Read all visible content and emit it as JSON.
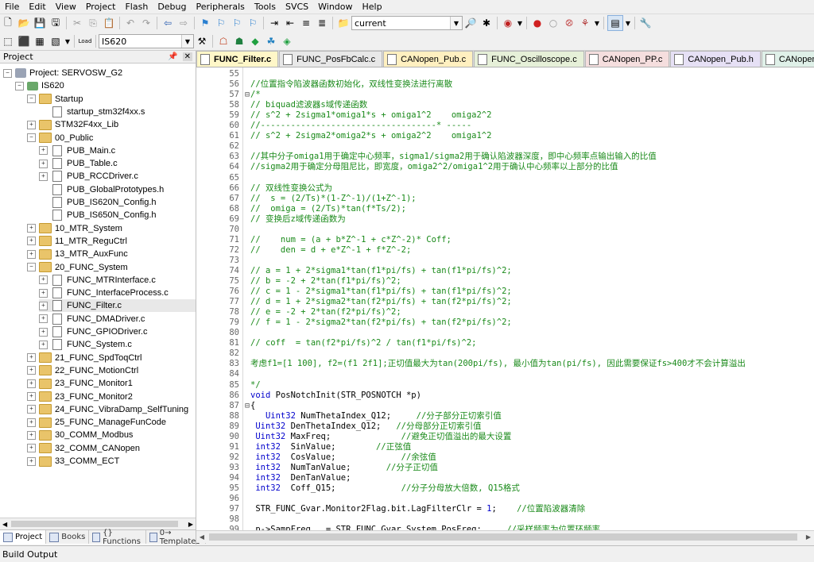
{
  "menu": [
    "File",
    "Edit",
    "View",
    "Project",
    "Flash",
    "Debug",
    "Peripherals",
    "Tools",
    "SVCS",
    "Window",
    "Help"
  ],
  "toolbar1": {
    "search_value": "current"
  },
  "toolbar2": {
    "load_label": "Load",
    "target_value": "IS620"
  },
  "project_pane": {
    "title": "Project",
    "tree": [
      {
        "label": "Project: SERVOSW_G2",
        "level": 0,
        "type": "proj",
        "toggle": "-"
      },
      {
        "label": "IS620",
        "level": 1,
        "type": "target",
        "toggle": "-"
      },
      {
        "label": "Startup",
        "level": 2,
        "type": "folder",
        "toggle": "-"
      },
      {
        "label": "startup_stm32f4xx.s",
        "level": 3,
        "type": "file",
        "toggle": ""
      },
      {
        "label": "STM32F4xx_Lib",
        "level": 2,
        "type": "folder",
        "toggle": "+"
      },
      {
        "label": "00_Public",
        "level": 2,
        "type": "folder",
        "toggle": "-"
      },
      {
        "label": "PUB_Main.c",
        "level": 3,
        "type": "file",
        "toggle": "+"
      },
      {
        "label": "PUB_Table.c",
        "level": 3,
        "type": "file",
        "toggle": "+"
      },
      {
        "label": "PUB_RCCDriver.c",
        "level": 3,
        "type": "file",
        "toggle": "+"
      },
      {
        "label": "PUB_GlobalPrototypes.h",
        "level": 3,
        "type": "file",
        "toggle": ""
      },
      {
        "label": "PUB_IS620N_Config.h",
        "level": 3,
        "type": "file",
        "toggle": ""
      },
      {
        "label": "PUB_IS650N_Config.h",
        "level": 3,
        "type": "file",
        "toggle": ""
      },
      {
        "label": "10_MTR_System",
        "level": 2,
        "type": "folder",
        "toggle": "+"
      },
      {
        "label": "11_MTR_ReguCtrl",
        "level": 2,
        "type": "folder",
        "toggle": "+"
      },
      {
        "label": "13_MTR_AuxFunc",
        "level": 2,
        "type": "folder",
        "toggle": "+"
      },
      {
        "label": "20_FUNC_System",
        "level": 2,
        "type": "folder",
        "toggle": "-"
      },
      {
        "label": "FUNC_MTRInterface.c",
        "level": 3,
        "type": "file",
        "toggle": "+"
      },
      {
        "label": "FUNC_InterfaceProcess.c",
        "level": 3,
        "type": "file",
        "toggle": "+"
      },
      {
        "label": "FUNC_Filter.c",
        "level": 3,
        "type": "file",
        "toggle": "+",
        "selected": true
      },
      {
        "label": "FUNC_DMADriver.c",
        "level": 3,
        "type": "file",
        "toggle": "+"
      },
      {
        "label": "FUNC_GPIODriver.c",
        "level": 3,
        "type": "file",
        "toggle": "+"
      },
      {
        "label": "FUNC_System.c",
        "level": 3,
        "type": "file",
        "toggle": "+"
      },
      {
        "label": "21_FUNC_SpdToqCtrl",
        "level": 2,
        "type": "folder",
        "toggle": "+"
      },
      {
        "label": "22_FUNC_MotionCtrl",
        "level": 2,
        "type": "folder",
        "toggle": "+"
      },
      {
        "label": "23_FUNC_Monitor1",
        "level": 2,
        "type": "folder",
        "toggle": "+"
      },
      {
        "label": "23_FUNC_Monitor2",
        "level": 2,
        "type": "folder",
        "toggle": "+"
      },
      {
        "label": "24_FUNC_VibraDamp_SelfTuning",
        "level": 2,
        "type": "folder",
        "toggle": "+"
      },
      {
        "label": "25_FUNC_ManageFunCode",
        "level": 2,
        "type": "folder",
        "toggle": "+"
      },
      {
        "label": "30_COMM_Modbus",
        "level": 2,
        "type": "folder",
        "toggle": "+"
      },
      {
        "label": "32_COMM_CANopen",
        "level": 2,
        "type": "folder",
        "toggle": "+"
      },
      {
        "label": "33_COMM_ECT",
        "level": 2,
        "type": "folder",
        "toggle": "+"
      }
    ],
    "bottom_tabs": [
      "Project",
      "Books",
      "{} Functions",
      "0→ Templates"
    ]
  },
  "editor_tabs": [
    {
      "label": "FUNC_Filter.c",
      "active": true,
      "color": "#fff7c8"
    },
    {
      "label": "FUNC_PosFbCalc.c",
      "active": false,
      "color": "#e8e8e8"
    },
    {
      "label": "CANopen_Pub.c",
      "active": false,
      "color": "#fff0c0"
    },
    {
      "label": "FUNC_Oscilloscope.c",
      "active": false,
      "color": "#e6f0d8"
    },
    {
      "label": "CANopen_PP.c",
      "active": false,
      "color": "#f5dede"
    },
    {
      "label": "CANopen_Pub.h",
      "active": false,
      "color": "#e6e0f5"
    },
    {
      "label": "CANopen_PP.h",
      "active": false,
      "color": "#dff0e8"
    }
  ],
  "code_lines": [
    {
      "n": "55",
      "fold": "",
      "t": "",
      "style": "normal"
    },
    {
      "n": "56",
      "fold": "",
      "t": "//位置指令陷波器函数初始化，双线性变换法进行离散",
      "style": "comment"
    },
    {
      "n": "57",
      "fold": "⊟",
      "t": "/*",
      "style": "comment"
    },
    {
      "n": "58",
      "fold": "",
      "t": "// biquad滤波器s域传递函数",
      "style": "comment"
    },
    {
      "n": "59",
      "fold": "",
      "t": "// s^2 + 2sigma1*omiga1*s + omiga1^2    omiga2^2",
      "style": "comment"
    },
    {
      "n": "60",
      "fold": "",
      "t": "//-----------------------------------* -----",
      "style": "comment"
    },
    {
      "n": "61",
      "fold": "",
      "t": "// s^2 + 2sigma2*omiga2*s + omiga2^2    omiga1^2",
      "style": "comment"
    },
    {
      "n": "62",
      "fold": "",
      "t": "",
      "style": "comment"
    },
    {
      "n": "63",
      "fold": "",
      "t": "//其中分子omiga1用于确定中心频率，sigma1/sigma2用于确认陷波器深度，即中心频率点输出输入的比值",
      "style": "comment"
    },
    {
      "n": "64",
      "fold": "",
      "t": "//sigma2用于确定分母阻尼比，即宽度，omiga2^2/omiga1^2用于确认中心频率以上部分的比值",
      "style": "comment"
    },
    {
      "n": "65",
      "fold": "",
      "t": "",
      "style": "comment"
    },
    {
      "n": "66",
      "fold": "",
      "t": "// 双线性变换公式为",
      "style": "comment"
    },
    {
      "n": "67",
      "fold": "",
      "t": "//  s = (2/Ts)*(1-Z^-1)/(1+Z^-1);",
      "style": "comment"
    },
    {
      "n": "68",
      "fold": "",
      "t": "//  omiga = (2/Ts)*tan(f*Ts/2);",
      "style": "comment"
    },
    {
      "n": "69",
      "fold": "",
      "t": "// 变换后z域传递函数为",
      "style": "comment"
    },
    {
      "n": "70",
      "fold": "",
      "t": "",
      "style": "comment"
    },
    {
      "n": "71",
      "fold": "",
      "t": "//    num = (a + b*Z^-1 + c*Z^-2)* Coff;",
      "style": "comment"
    },
    {
      "n": "72",
      "fold": "",
      "t": "//    den = d + e*Z^-1 + f*Z^-2;",
      "style": "comment"
    },
    {
      "n": "73",
      "fold": "",
      "t": "",
      "style": "comment"
    },
    {
      "n": "74",
      "fold": "",
      "t": "// a = 1 + 2*sigma1*tan(f1*pi/fs) + tan(f1*pi/fs)^2;",
      "style": "comment"
    },
    {
      "n": "75",
      "fold": "",
      "t": "// b = -2 + 2*tan(f1*pi/fs)^2;",
      "style": "comment"
    },
    {
      "n": "76",
      "fold": "",
      "t": "// c = 1 - 2*sigma1*tan(f1*pi/fs) + tan(f1*pi/fs)^2;",
      "style": "comment"
    },
    {
      "n": "77",
      "fold": "",
      "t": "// d = 1 + 2*sigma2*tan(f2*pi/fs) + tan(f2*pi/fs)^2;",
      "style": "comment"
    },
    {
      "n": "78",
      "fold": "",
      "t": "// e = -2 + 2*tan(f2*pi/fs)^2;",
      "style": "comment"
    },
    {
      "n": "79",
      "fold": "",
      "t": "// f = 1 - 2*sigma2*tan(f2*pi/fs) + tan(f2*pi/fs)^2;",
      "style": "comment"
    },
    {
      "n": "80",
      "fold": "",
      "t": "",
      "style": "comment"
    },
    {
      "n": "81",
      "fold": "",
      "t": "// coff  = tan(f2*pi/fs)^2 / tan(f1*pi/fs)^2;",
      "style": "comment"
    },
    {
      "n": "82",
      "fold": "",
      "t": "",
      "style": "comment"
    },
    {
      "n": "83",
      "fold": "",
      "t": "考虑f1=[1 100], f2=(f1 2f1];正切值最大为tan(200pi/fs), 最小值为tan(pi/fs), 因此需要保证fs>400才不会计算溢出",
      "style": "comment"
    },
    {
      "n": "84",
      "fold": "",
      "t": "",
      "style": "comment"
    },
    {
      "n": "85",
      "fold": "",
      "t": "*/",
      "style": "comment"
    },
    {
      "n": "86",
      "fold": "",
      "t": "void PosNotchInit(STR_POSNOTCH *p)",
      "style": "code"
    },
    {
      "n": "87",
      "fold": "⊟",
      "t": "{",
      "style": "code"
    },
    {
      "n": "88",
      "fold": "",
      "t": "   Uint32 NumThetaIndex_Q12;     ",
      "c": "//分子部分正切索引值",
      "style": "mixed"
    },
    {
      "n": "89",
      "fold": "",
      "t": " Uint32 DenThetaIndex_Q12;   ",
      "c": "//分母部分正切索引值",
      "style": "mixed"
    },
    {
      "n": "90",
      "fold": "",
      "t": " Uint32 MaxFreq;              ",
      "c": "//避免正切值溢出的最大设置",
      "style": "mixed"
    },
    {
      "n": "91",
      "fold": "",
      "t": " int32  SinValue;        ",
      "c": "//正弦值",
      "style": "mixed"
    },
    {
      "n": "92",
      "fold": "",
      "t": " int32  CosValue;             ",
      "c": "//余弦值",
      "style": "mixed"
    },
    {
      "n": "93",
      "fold": "",
      "t": " int32  NumTanValue;       ",
      "c": "//分子正切值",
      "style": "mixed"
    },
    {
      "n": "94",
      "fold": "",
      "t": " int32  DenTanValue;",
      "c": "",
      "style": "mixed"
    },
    {
      "n": "95",
      "fold": "",
      "t": " int32  Coff_Q15;             ",
      "c": "//分子分母放大倍数, Q15格式",
      "style": "mixed"
    },
    {
      "n": "96",
      "fold": "",
      "t": "",
      "style": "code"
    },
    {
      "n": "97",
      "fold": "",
      "t": " STR_FUNC_Gvar.Monitor2Flag.bit.LagFilterClr = 1;    ",
      "c": "//位置陷波器清除",
      "style": "mixed"
    },
    {
      "n": "98",
      "fold": "",
      "t": "",
      "style": "code"
    },
    {
      "n": "99",
      "fold": "",
      "t": " p->SampFreq   = STR_FUNC_Gvar.System.PosFreq;     ",
      "c": "//采样频率为位置环频率",
      "style": "mixed"
    }
  ],
  "build_output": {
    "title": "Build Output"
  }
}
